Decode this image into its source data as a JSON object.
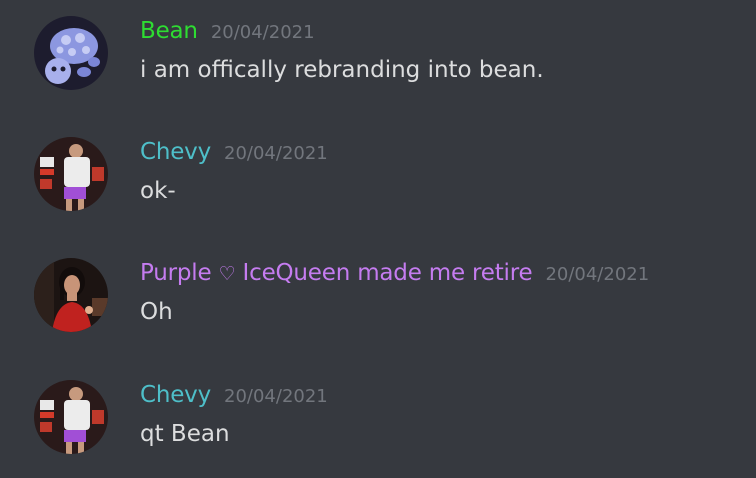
{
  "messages": [
    {
      "author": "Bean",
      "author_color": "#2edd32",
      "timestamp": "20/04/2021",
      "text": "i am offically rebranding into bean.",
      "avatar_icon": "turtle-plush-avatar"
    },
    {
      "author": "Chevy",
      "author_color": "#4ebfc9",
      "timestamp": "20/04/2021",
      "text": "ok-",
      "avatar_icon": "person-photo-avatar"
    },
    {
      "author_prefix": "Purple",
      "author_symbol": "♡",
      "author_suffix": "IceQueen made me retire",
      "author_color": "#c57cf0",
      "timestamp": "20/04/2021",
      "text": "Oh",
      "avatar_icon": "woman-red-dress-avatar"
    },
    {
      "author": "Chevy",
      "author_color": "#4ebfc9",
      "timestamp": "20/04/2021",
      "text": "qt Bean",
      "avatar_icon": "person-photo-avatar"
    }
  ],
  "colors": {
    "background": "#36393f",
    "text": "#dcddde",
    "timestamp": "#72767d"
  }
}
